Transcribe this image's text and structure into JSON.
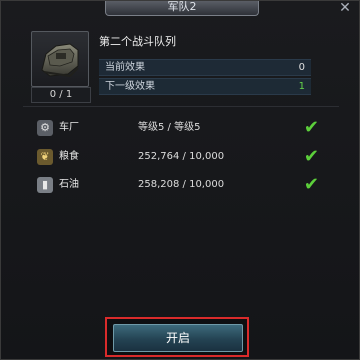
{
  "window": {
    "title": "军队2",
    "close_glyph": "✕"
  },
  "item": {
    "count": "0 / 1"
  },
  "queue": {
    "title": "第二个战斗队列"
  },
  "effects": [
    {
      "label": "当前效果",
      "value": "0"
    },
    {
      "label": "下一级效果",
      "value": "1"
    }
  ],
  "requirements": [
    {
      "icon": "garage-icon",
      "name": "车厂",
      "value": "等级5 / 等级5",
      "met": true
    },
    {
      "icon": "food-icon",
      "name": "粮食",
      "value": "252,764 / 10,000",
      "met": true
    },
    {
      "icon": "oil-icon",
      "name": "石油",
      "value": "258,208 / 10,000",
      "met": true
    }
  ],
  "action": {
    "open_label": "开启"
  },
  "colors": {
    "check": "#5ccf3b",
    "next_effect": "#66d64b",
    "button_highlight": "#d92b2b"
  }
}
